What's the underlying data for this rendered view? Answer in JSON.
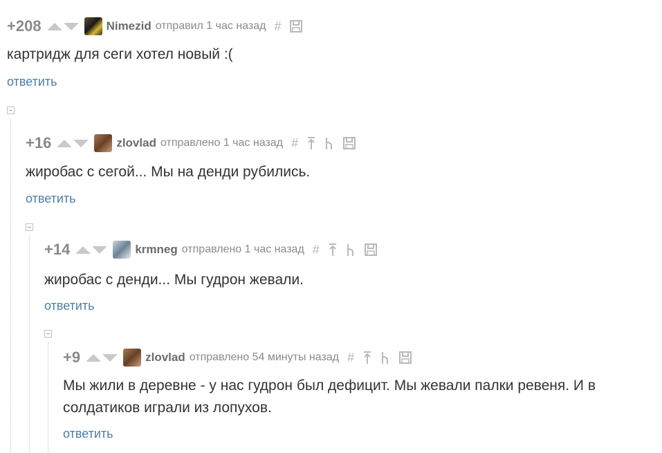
{
  "comments": [
    {
      "rating": "+208",
      "author": "Nimezid",
      "action": "отправил 1 час назад",
      "text": "картридж для сеги хотел новый :(",
      "reply": "ответить",
      "avatar_colors": [
        "#5a5030",
        "#d8b830"
      ]
    },
    {
      "rating": "+16",
      "author": "zlovlad",
      "action": "отправлено 1 час назад",
      "text": "жиробас с сегой... Мы на денди рубились.",
      "reply": "ответить",
      "avatar_colors": [
        "#a47a5a",
        "#6a4024"
      ]
    },
    {
      "rating": "+14",
      "author": "krmneg",
      "action": "отправлено 1 час назад",
      "text": "жиробас с денди... Мы гудрон жевали.",
      "reply": "ответить",
      "avatar_colors": [
        "#c8d4de",
        "#6d8296"
      ]
    },
    {
      "rating": "+9",
      "author": "zlovlad",
      "action": "отправлено 54 минуты назад",
      "text_line1": "Мы жили в деревне - у нас гудрон был дефицит. Мы жевали палки ревеня. И в",
      "text_line2": "солдатиков играли из лопухов.",
      "reply": "ответить",
      "avatar_colors": [
        "#a47a5a",
        "#6a4024"
      ]
    }
  ],
  "icons": [
    "hash-icon",
    "arrow-up-parent-icon",
    "branch-icon",
    "save-icon"
  ],
  "colors": {
    "link": "#4a7fa8",
    "muted": "#8a8a8a",
    "text": "#333333"
  }
}
